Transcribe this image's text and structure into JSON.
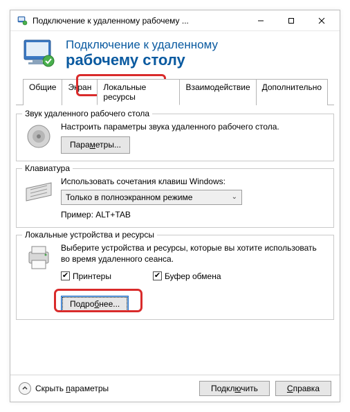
{
  "titlebar": {
    "text": "Подключение к удаленному рабочему ..."
  },
  "header": {
    "line1": "Подключение к удаленному",
    "line2": "рабочему столу"
  },
  "tabs": {
    "general": "Общие",
    "display": "Экран",
    "local": "Локальные ресурсы",
    "experience": "Взаимодействие",
    "advanced": "Дополнительно"
  },
  "group_sound": {
    "title": "Звук удаленного рабочего стола",
    "text": "Настроить параметры звука удаленного рабочего стола.",
    "button": "Параметры..."
  },
  "group_keyboard": {
    "title": "Клавиатура",
    "text": "Использовать сочетания клавиш Windows:",
    "select_value": "Только в полноэкранном режиме",
    "example": "Пример: ALT+TAB"
  },
  "group_local": {
    "title": "Локальные устройства и ресурсы",
    "text": "Выберите устройства и ресурсы, которые вы хотите использовать во время удаленного сеанса.",
    "chk_printers": "Принтеры",
    "chk_clipboard": "Буфер обмена",
    "button": "Подробнее..."
  },
  "bottom": {
    "hide": "Скрыть параметры",
    "connect": "Подключить",
    "help": "Справка"
  }
}
